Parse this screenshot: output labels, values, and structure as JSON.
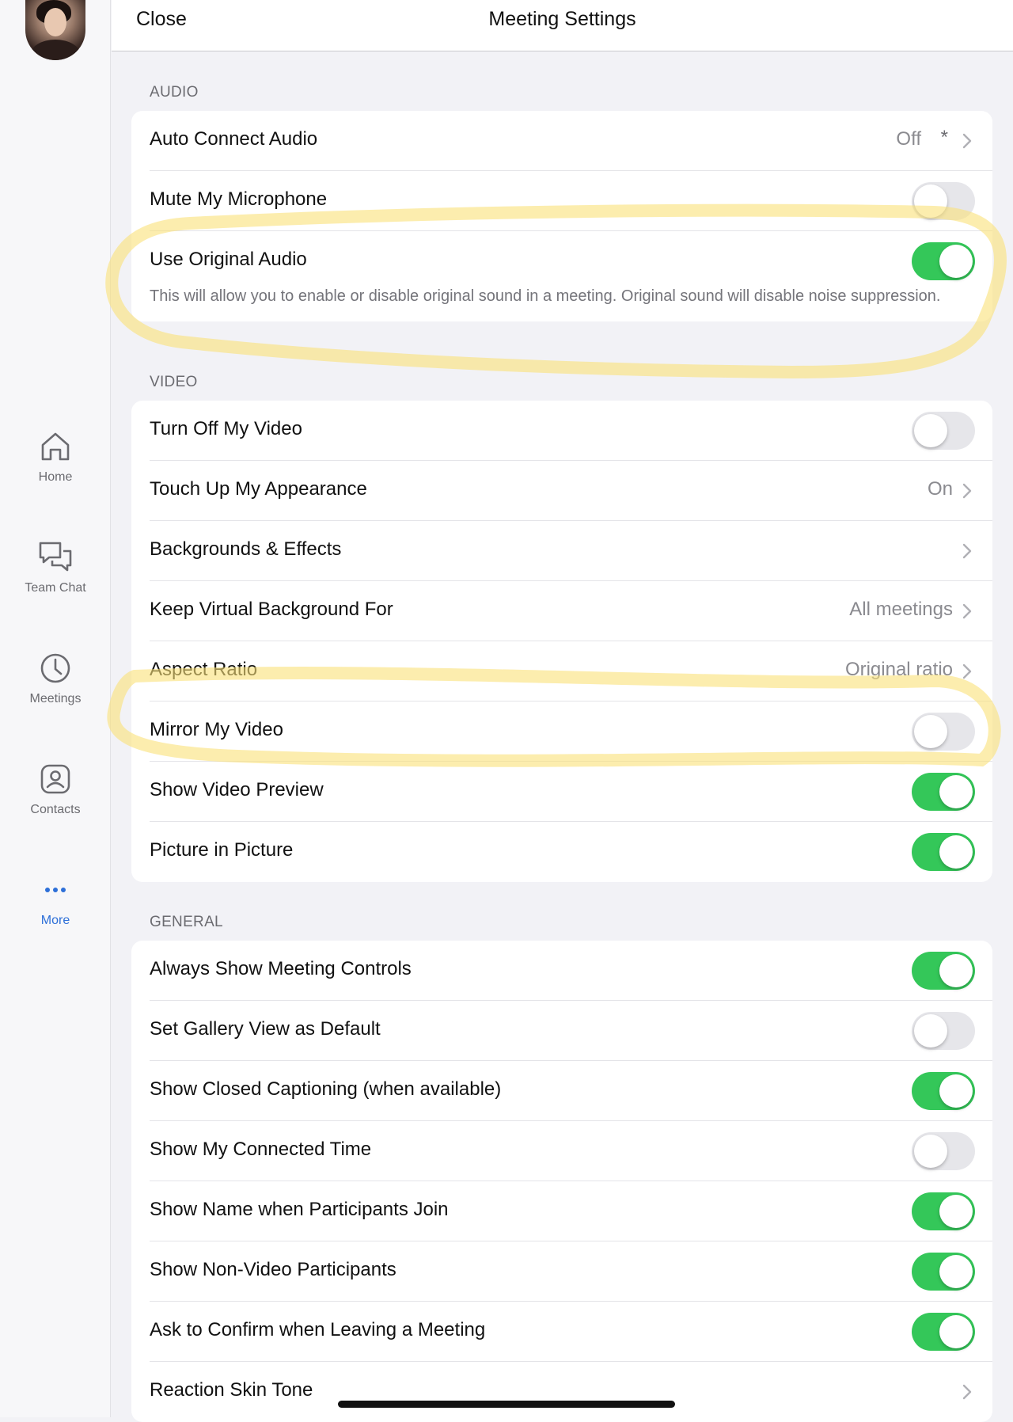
{
  "header": {
    "close_label": "Close",
    "title": "Meeting Settings"
  },
  "sidebar": {
    "items": [
      {
        "label": "Home",
        "icon": "home-icon"
      },
      {
        "label": "Team Chat",
        "icon": "chat-icon"
      },
      {
        "label": "Meetings",
        "icon": "clock-icon"
      },
      {
        "label": "Contacts",
        "icon": "contacts-icon"
      },
      {
        "label": "More",
        "icon": "more-icon"
      }
    ]
  },
  "audio": {
    "header": "AUDIO",
    "auto_connect": {
      "label": "Auto Connect Audio",
      "value": "Off",
      "asterisk": "*"
    },
    "mute_mic": {
      "label": "Mute My Microphone",
      "on": false
    },
    "original_audio": {
      "label": "Use Original Audio",
      "on": true,
      "description": "This will allow you to enable or disable original sound in a meeting. Original sound will disable noise suppression."
    }
  },
  "video": {
    "header": "VIDEO",
    "turn_off_video": {
      "label": "Turn Off My Video",
      "on": false
    },
    "touch_up": {
      "label": "Touch Up My Appearance",
      "value": "On"
    },
    "backgrounds": {
      "label": "Backgrounds & Effects"
    },
    "keep_virtual_bg": {
      "label": "Keep Virtual Background For",
      "value": "All meetings"
    },
    "aspect_ratio": {
      "label": "Aspect Ratio",
      "value": "Original ratio"
    },
    "mirror": {
      "label": "Mirror My Video",
      "on": false
    },
    "preview": {
      "label": "Show Video Preview",
      "on": true
    },
    "pip": {
      "label": "Picture in Picture",
      "on": true
    }
  },
  "general": {
    "header": "GENERAL",
    "rows": [
      {
        "label": "Always Show Meeting Controls",
        "on": true
      },
      {
        "label": "Set Gallery View as Default",
        "on": false
      },
      {
        "label": "Show Closed Captioning (when available)",
        "on": true
      },
      {
        "label": "Show My Connected Time",
        "on": false
      },
      {
        "label": "Show Name when Participants Join",
        "on": true
      },
      {
        "label": "Show Non-Video Participants",
        "on": true
      },
      {
        "label": "Ask to Confirm when Leaving a Meeting",
        "on": true
      }
    ],
    "reaction_skin_tone": {
      "label": "Reaction Skin Tone"
    }
  },
  "colors": {
    "toggle_on": "#34c759",
    "toggle_off": "#e6e6ea",
    "accent": "#2d6fd8",
    "highlight": "#fae178"
  }
}
